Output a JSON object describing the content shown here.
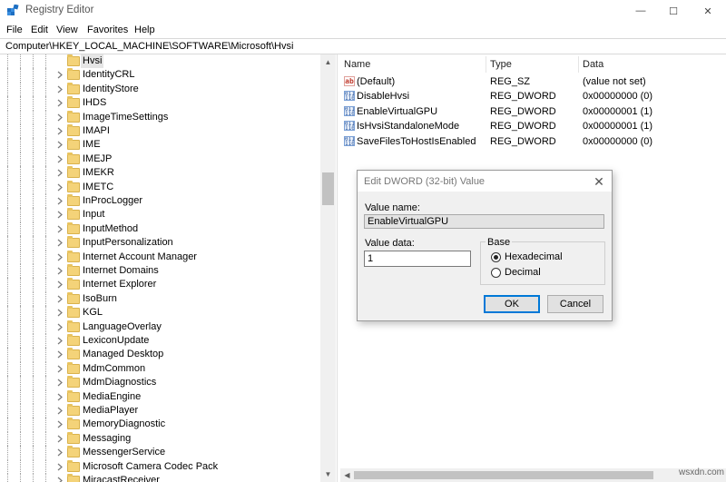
{
  "window": {
    "title": "Registry Editor",
    "minimize_glyph": "—",
    "maximize_glyph": "☐",
    "close_glyph": "✕"
  },
  "menu": {
    "file": "File",
    "edit": "Edit",
    "view": "View",
    "favorites": "Favorites",
    "help": "Help"
  },
  "address": "Computer\\HKEY_LOCAL_MACHINE\\SOFTWARE\\Microsoft\\Hvsi",
  "tree": {
    "items": [
      {
        "label": "Hvsi",
        "selected": true
      },
      {
        "label": "IdentityCRL"
      },
      {
        "label": "IdentityStore"
      },
      {
        "label": "IHDS"
      },
      {
        "label": "ImageTimeSettings"
      },
      {
        "label": "IMAPI"
      },
      {
        "label": "IME"
      },
      {
        "label": "IMEJP"
      },
      {
        "label": "IMEKR"
      },
      {
        "label": "IMETC"
      },
      {
        "label": "InProcLogger"
      },
      {
        "label": "Input"
      },
      {
        "label": "InputMethod"
      },
      {
        "label": "InputPersonalization"
      },
      {
        "label": "Internet Account Manager"
      },
      {
        "label": "Internet Domains"
      },
      {
        "label": "Internet Explorer"
      },
      {
        "label": "IsoBurn"
      },
      {
        "label": "KGL"
      },
      {
        "label": "LanguageOverlay"
      },
      {
        "label": "LexiconUpdate"
      },
      {
        "label": "Managed Desktop"
      },
      {
        "label": "MdmCommon"
      },
      {
        "label": "MdmDiagnostics"
      },
      {
        "label": "MediaEngine"
      },
      {
        "label": "MediaPlayer"
      },
      {
        "label": "MemoryDiagnostic"
      },
      {
        "label": "Messaging"
      },
      {
        "label": "MessengerService"
      },
      {
        "label": "Microsoft Camera Codec Pack"
      },
      {
        "label": "MiracastReceiver"
      }
    ]
  },
  "values_list": {
    "columns": {
      "name": "Name",
      "type": "Type",
      "data": "Data"
    },
    "rows": [
      {
        "icon": "string-value-icon",
        "icon_text": "ab",
        "name": "(Default)",
        "type": "REG_SZ",
        "data": "(value not set)"
      },
      {
        "icon": "dword-value-icon",
        "icon_text": "011 110",
        "name": "DisableHvsi",
        "type": "REG_DWORD",
        "data": "0x00000000 (0)"
      },
      {
        "icon": "dword-value-icon",
        "icon_text": "011 110",
        "name": "EnableVirtualGPU",
        "type": "REG_DWORD",
        "data": "0x00000001 (1)"
      },
      {
        "icon": "dword-value-icon",
        "icon_text": "011 110",
        "name": "IsHvsiStandaloneMode",
        "type": "REG_DWORD",
        "data": "0x00000001 (1)"
      },
      {
        "icon": "dword-value-icon",
        "icon_text": "011 110",
        "name": "SaveFilesToHostIsEnabled",
        "type": "REG_DWORD",
        "data": "0x00000000 (0)"
      }
    ]
  },
  "dialog": {
    "title": "Edit DWORD (32-bit) Value",
    "value_name_label": "Value name:",
    "value_name": "EnableVirtualGPU",
    "value_data_label": "Value data:",
    "value_data": "1",
    "base_label": "Base",
    "hex_label": "Hexadecimal",
    "dec_label": "Decimal",
    "base_selected": "Hexadecimal",
    "ok_label": "OK",
    "cancel_label": "Cancel",
    "close_glyph": "✕"
  },
  "watermark": "wsxdn.com",
  "colors": {
    "accent": "#0078d7",
    "folder": "#f4d379"
  }
}
